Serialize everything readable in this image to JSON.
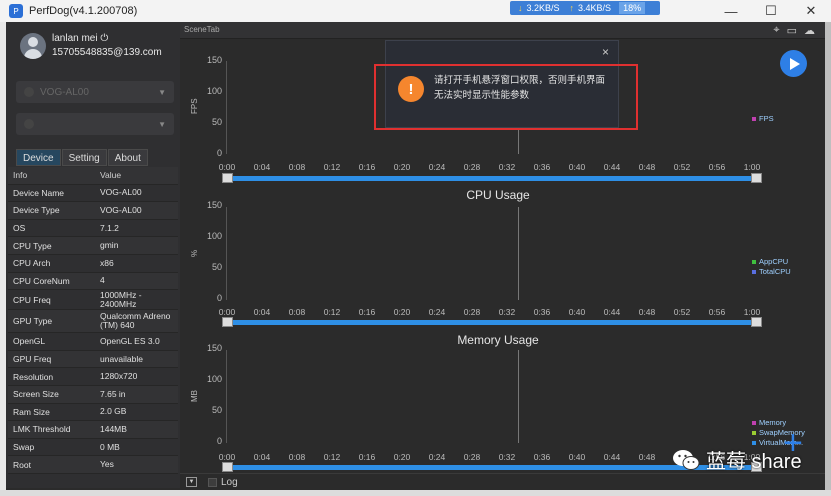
{
  "window": {
    "title": "PerfDog(v4.1.200708)"
  },
  "netstats": {
    "download": "3.2KB/S",
    "upload": "3.4KB/S",
    "cpu": "18%"
  },
  "user": {
    "name": "lanlan mei",
    "email": "15705548835@139.com"
  },
  "device_select": {
    "value": "VOG-AL00"
  },
  "app_select": {
    "value": ""
  },
  "tabs": [
    {
      "label": "Device"
    },
    {
      "label": "Setting"
    },
    {
      "label": "About"
    }
  ],
  "info_table": {
    "header": {
      "key": "Info",
      "value": "Value"
    },
    "rows": [
      {
        "key": "Device Name",
        "value": "VOG-AL00"
      },
      {
        "key": "Device Type",
        "value": "VOG-AL00"
      },
      {
        "key": "OS",
        "value": "7.1.2"
      },
      {
        "key": "CPU Type",
        "value": "gmin"
      },
      {
        "key": "CPU Arch",
        "value": "x86"
      },
      {
        "key": "CPU CoreNum",
        "value": "4"
      },
      {
        "key": "CPU Freq",
        "value": "1000MHz - 2400MHz"
      },
      {
        "key": "GPU Type",
        "value": "Qualcomm Adreno (TM) 640"
      },
      {
        "key": "OpenGL",
        "value": "OpenGL ES 3.0"
      },
      {
        "key": "GPU Freq",
        "value": "unavailable"
      },
      {
        "key": "Resolution",
        "value": "1280x720"
      },
      {
        "key": "Screen Size",
        "value": "7.65 in"
      },
      {
        "key": "Ram Size",
        "value": "2.0 GB"
      },
      {
        "key": "LMK Threshold",
        "value": "144MB"
      },
      {
        "key": "Swap",
        "value": "0 MB"
      },
      {
        "key": "Root",
        "value": "Yes"
      }
    ]
  },
  "scene_tab": {
    "label": "SceneTab"
  },
  "popup": {
    "message": "请打开手机悬浮窗口权限，否则手机界面无法实时显示性能参数",
    "close": "×"
  },
  "charts": {
    "time_ticks": [
      "0:00",
      "0:04",
      "0:08",
      "0:12",
      "0:16",
      "0:20",
      "0:24",
      "0:28",
      "0:32",
      "0:36",
      "0:40",
      "0:44",
      "0:48",
      "0:52",
      "0:56",
      "1:00"
    ],
    "y_ticks": [
      "150",
      "100",
      "50",
      "0"
    ],
    "fps": {
      "ylabel": "FPS",
      "legend": [
        "FPS"
      ]
    },
    "cpu": {
      "title": "CPU Usage",
      "ylabel": "%",
      "legend": [
        "AppCPU",
        "TotalCPU"
      ]
    },
    "memory": {
      "title": "Memory Usage",
      "ylabel": "MB",
      "legend": [
        "Memory",
        "SwapMemory",
        "VirtualMem..."
      ]
    }
  },
  "legend_colors": {
    "FPS": "#c040b0",
    "AppCPU": "#3fbf3f",
    "TotalCPU": "#5a6fe0",
    "Memory": "#c040b0",
    "SwapMemory": "#9acd32",
    "VirtualMem": "#2e8fe6"
  },
  "bottom": {
    "log_label": "Log"
  },
  "watermark": {
    "text": "蓝莓 share"
  }
}
